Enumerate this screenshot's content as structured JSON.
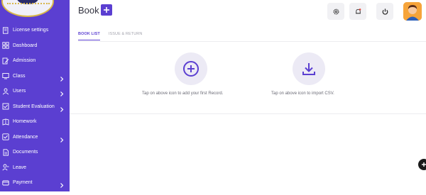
{
  "sidebar": {
    "items": [
      {
        "label": "License settings",
        "icon": "license-icon",
        "has_children": false
      },
      {
        "label": "Dashboard",
        "icon": "dashboard-icon",
        "has_children": false
      },
      {
        "label": "Admission",
        "icon": "admission-icon",
        "has_children": false
      },
      {
        "label": "Class",
        "icon": "class-icon",
        "has_children": true
      },
      {
        "label": "Users",
        "icon": "users-icon",
        "has_children": true
      },
      {
        "label": "Student Evaluation",
        "icon": "evaluation-icon",
        "has_children": true
      },
      {
        "label": "Homework",
        "icon": "homework-icon",
        "has_children": false
      },
      {
        "label": "Attendance",
        "icon": "attendance-icon",
        "has_children": true
      },
      {
        "label": "Documents",
        "icon": "documents-icon",
        "has_children": false
      },
      {
        "label": "Leave",
        "icon": "leave-icon",
        "has_children": false
      },
      {
        "label": "Payment",
        "icon": "payment-icon",
        "has_children": true
      }
    ]
  },
  "header": {
    "title": "Book",
    "add_icon": "plus-icon",
    "actions": [
      {
        "icon": "settings-icon"
      },
      {
        "icon": "notification-bell-icon"
      },
      {
        "icon": "power-icon"
      }
    ],
    "avatar_icon": "user-avatar"
  },
  "tabs": [
    {
      "label": "BOOK LIST",
      "active": true
    },
    {
      "label": "ISSUE & RETURN",
      "active": false
    }
  ],
  "empty_state": {
    "add": {
      "icon": "add-circle-icon",
      "text": "Tap on above icon to add your first Record."
    },
    "import": {
      "icon": "download-icon",
      "text": "Tap on above icon to import CSV."
    }
  },
  "colors": {
    "brand": "#5b3fd1",
    "icon_bg": "#eceaf5"
  }
}
